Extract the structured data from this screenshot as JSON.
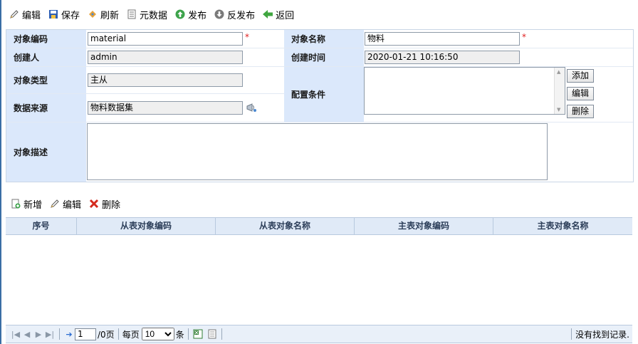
{
  "toolbar": {
    "items": [
      {
        "label": "编辑",
        "icon": "pencil-icon"
      },
      {
        "label": "保存",
        "icon": "save-icon"
      },
      {
        "label": "刷新",
        "icon": "refresh-icon"
      },
      {
        "label": "元数据",
        "icon": "metadata-icon"
      },
      {
        "label": "发布",
        "icon": "publish-icon"
      },
      {
        "label": "反发布",
        "icon": "unpublish-icon"
      },
      {
        "label": "返回",
        "icon": "back-icon"
      }
    ]
  },
  "form": {
    "object_code_label": "对象编码",
    "object_code_value": "material",
    "object_name_label": "对象名称",
    "object_name_value": "物料",
    "creator_label": "创建人",
    "creator_value": "admin",
    "created_time_label": "创建时间",
    "created_time_value": "2020-01-21 10:16:50",
    "object_type_label": "对象类型",
    "object_type_value": "主从",
    "config_label": "配置条件",
    "datasource_label": "数据来源",
    "datasource_value": "物料数据集",
    "description_label": "对象描述",
    "description_value": "",
    "add_button": "添加",
    "edit_button": "编辑",
    "delete_button": "删除",
    "required_mark": "*"
  },
  "toolbar2": {
    "items": [
      {
        "label": "新增",
        "icon": "add-doc-icon"
      },
      {
        "label": "编辑",
        "icon": "pencil-icon"
      },
      {
        "label": "删除",
        "icon": "delete-icon"
      }
    ]
  },
  "grid": {
    "columns": [
      "序号",
      "从表对象编码",
      "从表对象名称",
      "主表对象编码",
      "主表对象名称"
    ],
    "rows": []
  },
  "pager": {
    "page_value": "1",
    "page_suffix": "/0页",
    "per_page_label": "每页",
    "per_page_value": "10",
    "per_page_unit": "条",
    "status": "没有找到记录."
  }
}
